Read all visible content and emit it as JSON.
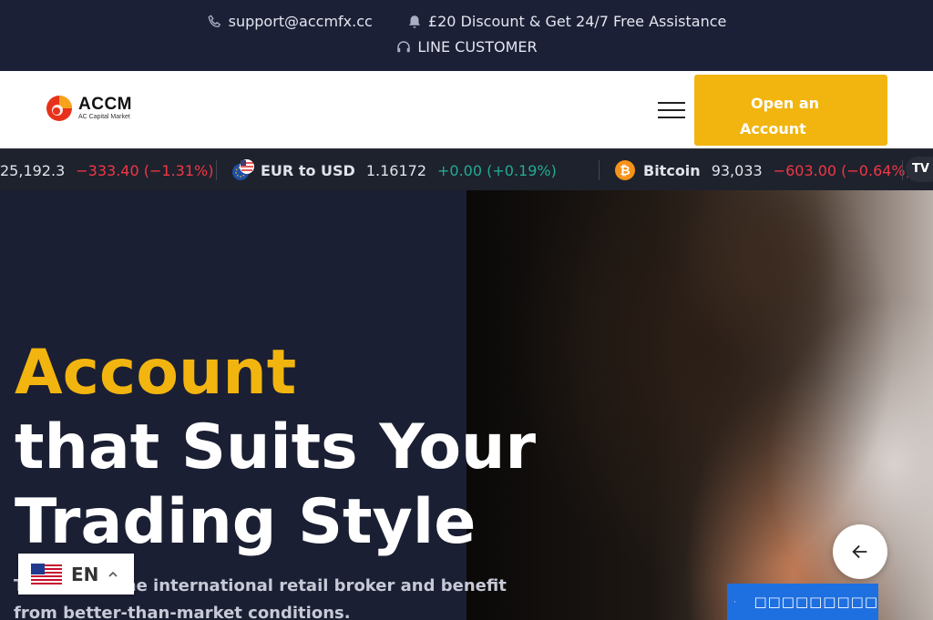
{
  "topbar": {
    "email": "support@accmfx.cc",
    "promo": "£20 Discount & Get 24/7 Free Assistance",
    "line_customer": "LINE CUSTOMER"
  },
  "header": {
    "logo_text": "ACCM",
    "logo_subtext": "AC Capital Market",
    "cta_line1": "Open an",
    "cta_line2": "Account"
  },
  "ticker": {
    "items": [
      {
        "symbol": "",
        "price": "25,192.3",
        "change": "−333.40 (−1.31%)",
        "direction": "neg"
      },
      {
        "symbol": "EUR to USD",
        "price": "1.16172",
        "change": "+0.00 (+0.19%)",
        "direction": "pos"
      },
      {
        "symbol": "Bitcoin",
        "price": "93,033",
        "change": "−603.00 (−0.64%)",
        "direction": "neg"
      }
    ],
    "provider_logo": "TV"
  },
  "hero": {
    "title_accent": "Account",
    "title_line2": "that Suits Your",
    "title_line3": "Trading Style",
    "subtitle": "Trade with the international retail broker and benefit from better-than-market conditions."
  },
  "language": {
    "code": "EN"
  },
  "chat": {
    "label": "□□□□□□□□□"
  },
  "colors": {
    "accent": "#f2b50f",
    "dark_bg": "#1c2036",
    "ticker_bg": "#1e222d",
    "negative": "#f23645",
    "positive": "#22ab94",
    "chat_blue": "#1e6fe0"
  }
}
